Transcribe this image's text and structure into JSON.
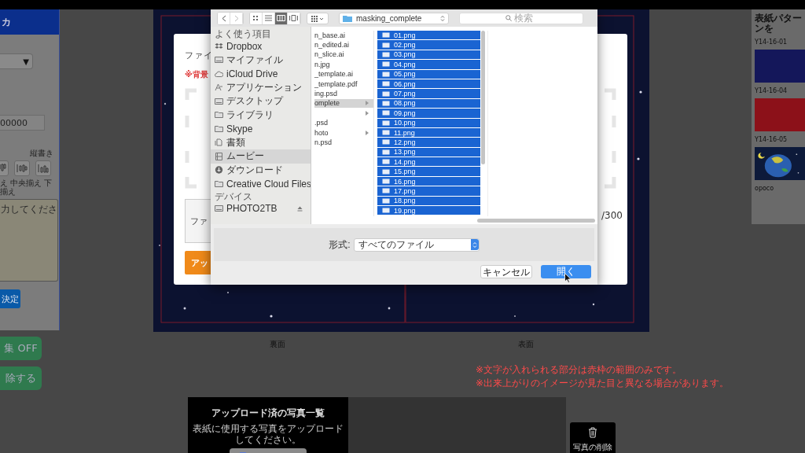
{
  "left_panel": {
    "header": "カ",
    "select_arrow": "▼",
    "number_field": "00000",
    "vertical_label": "縦書き",
    "align_buttons": [
      {
        "kind": "top",
        "selected": false
      },
      {
        "kind": "middle",
        "selected": false
      },
      {
        "kind": "bottom",
        "selected": false
      }
    ],
    "align_labels": "え 中央揃え 下揃え",
    "textarea_placeholder": "力してくださ",
    "confirm_button": "決定"
  },
  "side_buttons": [
    "集 OFF",
    "除する"
  ],
  "modal": {
    "title": "ファイ",
    "warning": "※背景",
    "file_field": "ファ",
    "counter": "/300",
    "upload_button": "アッ"
  },
  "file_dialog": {
    "view_buttons": [
      {
        "kind": "icons",
        "selected": false
      },
      {
        "kind": "list",
        "selected": false
      },
      {
        "kind": "columns",
        "selected": true
      },
      {
        "kind": "cover",
        "selected": false
      }
    ],
    "path": "masking_complete",
    "search_placeholder": "検索",
    "sidebar": [
      {
        "heading": "よく使う項目",
        "items": [
          {
            "name": "Dropbox",
            "kind": "box",
            "selected": false
          },
          {
            "name": "マイファイル",
            "kind": "drive",
            "selected": false
          },
          {
            "name": "iCloud Drive",
            "kind": "cloud",
            "selected": false
          },
          {
            "name": "アプリケーション",
            "kind": "app",
            "selected": false
          },
          {
            "name": "デスクトップ",
            "kind": "drive",
            "selected": false
          },
          {
            "name": "ライブラリ",
            "kind": "folder",
            "selected": false
          },
          {
            "name": "Skype",
            "kind": "folder",
            "selected": false
          },
          {
            "name": "書類",
            "kind": "doc",
            "selected": false
          },
          {
            "name": "ムービー",
            "kind": "film",
            "selected": true
          },
          {
            "name": "ダウンロード",
            "kind": "download",
            "selected": false
          },
          {
            "name": "Creative Cloud Files",
            "kind": "folder",
            "selected": false
          }
        ]
      },
      {
        "heading": "デバイス",
        "items": [
          {
            "name": "PHOTO2TB",
            "kind": "drive",
            "selected": false
          }
        ]
      }
    ],
    "column_1": [
      {
        "name": "n_base.ai",
        "folder": false,
        "selected": false
      },
      {
        "name": "n_edited.ai",
        "folder": false,
        "selected": false
      },
      {
        "name": "n_slice.ai",
        "folder": false,
        "selected": false
      },
      {
        "name": "n.jpg",
        "folder": false,
        "selected": false
      },
      {
        "name": "_template.ai",
        "folder": false,
        "selected": false
      },
      {
        "name": "_template.pdf",
        "folder": false,
        "selected": false
      },
      {
        "name": "ing.psd",
        "folder": false,
        "selected": false
      },
      {
        "name": "omplete",
        "folder": true,
        "selected": true
      },
      {
        "folder": true,
        "selected": false
      },
      {
        "name": ".psd",
        "folder": false,
        "selected": false
      },
      {
        "name": "hoto",
        "folder": true,
        "selected": false
      },
      {
        "name": "n.psd",
        "folder": false,
        "selected": false
      }
    ],
    "column_2": [
      {
        "name": "01.png",
        "selected": true
      },
      {
        "name": "02.png",
        "selected": true
      },
      {
        "name": "03.png",
        "selected": true
      },
      {
        "name": "04.png",
        "selected": true
      },
      {
        "name": "05.png",
        "selected": true
      },
      {
        "name": "06.png",
        "selected": true
      },
      {
        "name": "07.png",
        "selected": true
      },
      {
        "name": "08.png",
        "selected": true
      },
      {
        "name": "09.png",
        "selected": true
      },
      {
        "name": "10.png",
        "selected": true
      },
      {
        "name": "11.png",
        "selected": true
      },
      {
        "name": "12.png",
        "selected": true
      },
      {
        "name": "13.png",
        "selected": true
      },
      {
        "name": "14.png",
        "selected": true
      },
      {
        "name": "15.png",
        "selected": true
      },
      {
        "name": "16.png",
        "selected": true
      },
      {
        "name": "17.png",
        "selected": true
      },
      {
        "name": "18.png",
        "selected": true
      },
      {
        "name": "19.png",
        "selected": true
      }
    ],
    "format_label": "形式:",
    "format_value": "すべてのファイル",
    "cancel_button": "キャンセル",
    "open_button": "開く"
  },
  "preview_labels": [
    "裏面",
    "表面"
  ],
  "notes": [
    "※文字が入れられる部分は赤枠の範囲のみです。",
    "※出来上がりのイメージが見た目と異なる場合があります。"
  ],
  "uploaded": {
    "title": "アップロード済の写真一覧",
    "description": "表紙に使用する写真をアップロードしてください。"
  },
  "delete_photo_button": "写真の削除",
  "patterns": {
    "title": "表紙パターンを",
    "items": [
      {
        "code": "Y14-16-01",
        "kind": "color",
        "color": "#14175a"
      },
      {
        "code": "Y14-16-04",
        "kind": "color",
        "color": "#8c1119"
      },
      {
        "code": "Y14-16-05",
        "kind": "picture"
      }
    ],
    "caption": "opoco"
  }
}
